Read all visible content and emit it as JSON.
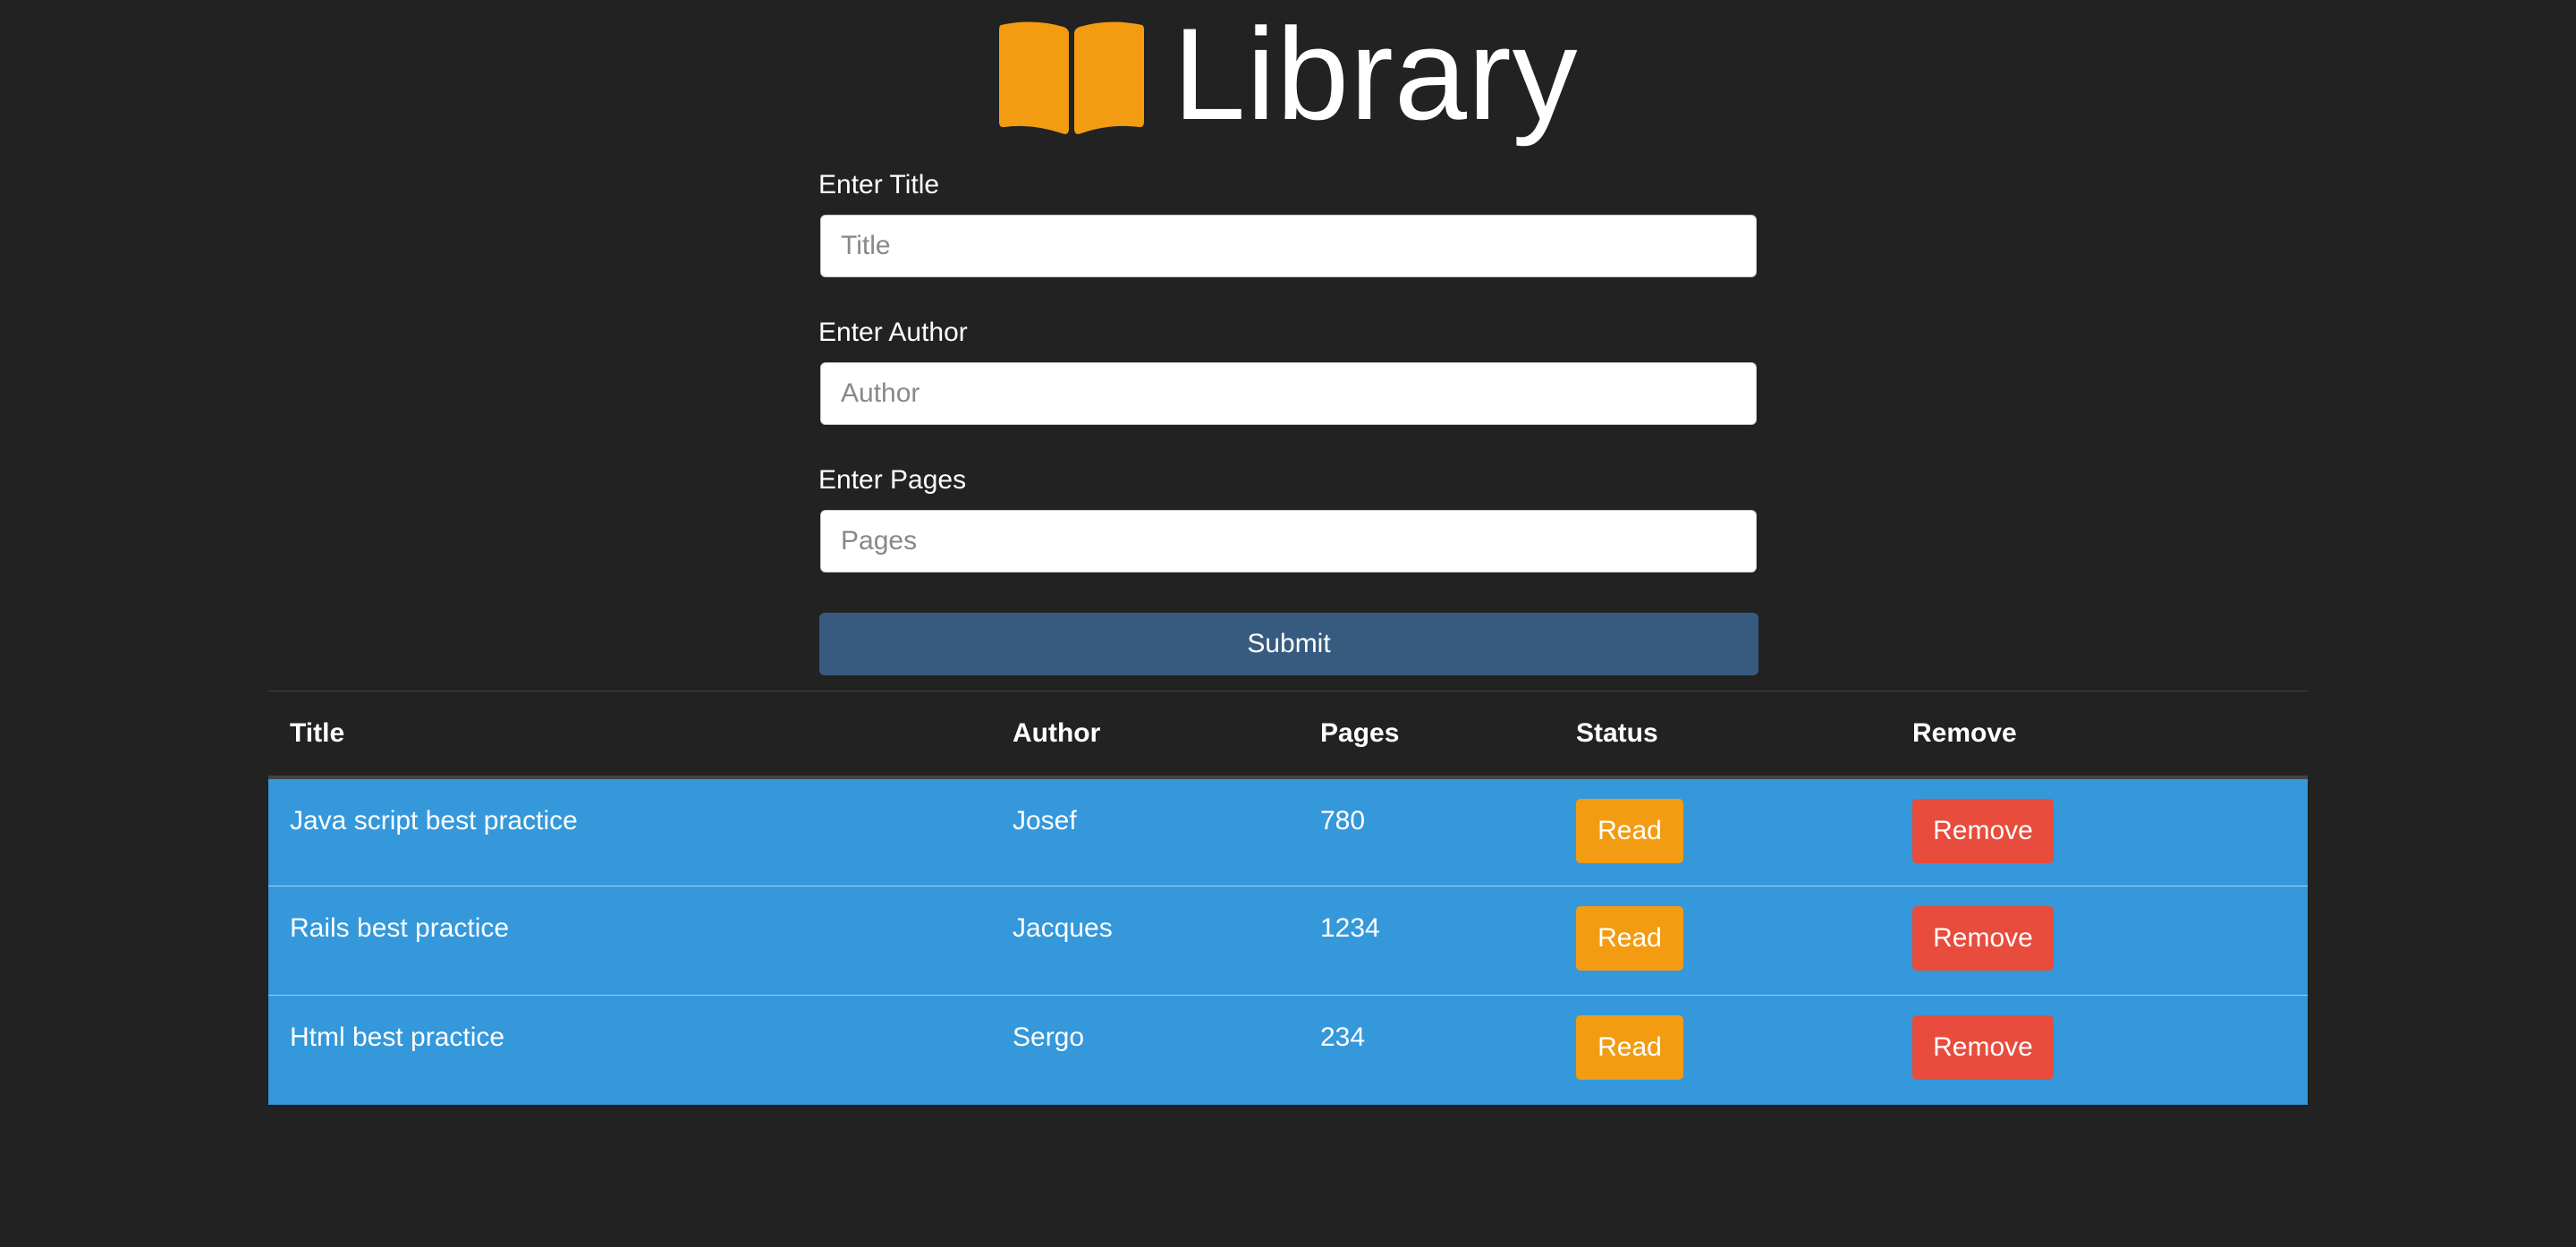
{
  "header": {
    "title": "Library",
    "icon": "open-book-icon",
    "icon_color": "#f39c12"
  },
  "form": {
    "title_label": "Enter Title",
    "title_placeholder": "Title",
    "author_label": "Enter Author",
    "author_placeholder": "Author",
    "pages_label": "Enter Pages",
    "pages_placeholder": "Pages",
    "submit_label": "Submit",
    "submit_color": "#375a7f"
  },
  "table": {
    "columns": [
      "Title",
      "Author",
      "Pages",
      "Status",
      "Remove"
    ],
    "rows": [
      {
        "title": "Java script best practice",
        "author": "Josef",
        "pages": "780",
        "status": "Read",
        "remove": "Remove"
      },
      {
        "title": "Rails best practice",
        "author": "Jacques",
        "pages": "1234",
        "status": "Read",
        "remove": "Remove"
      },
      {
        "title": "Html best practice",
        "author": "Sergo",
        "pages": "234",
        "status": "Read",
        "remove": "Remove"
      }
    ],
    "row_color": "#3498db",
    "read_color": "#f39c12",
    "remove_color": "#e74c3c"
  }
}
